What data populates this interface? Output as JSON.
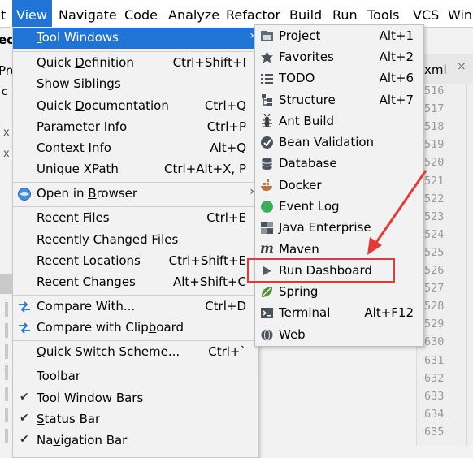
{
  "menubar": {
    "items": [
      "t",
      "View",
      "Navigate",
      "Code",
      "Analyze",
      "Refactor",
      "Build",
      "Run",
      "Tools",
      "VCS",
      "Win"
    ]
  },
  "background": {
    "left_fragments": [
      "ec",
      "Pro",
      "c",
      "x",
      "x"
    ],
    "tab_fragment": "xml",
    "line_numbers": [
      "516",
      "517",
      "518",
      "519",
      "520",
      "521",
      "522",
      "523",
      "524",
      "525",
      "526",
      "527",
      "528",
      "529",
      "630",
      "631",
      "632",
      "633",
      "634",
      "635"
    ]
  },
  "view_menu": {
    "items": [
      {
        "label": "Tool Windows",
        "shortcut": "",
        "submenu": true,
        "highlighted": true
      },
      {
        "label": "Quick Definition",
        "shortcut": "Ctrl+Shift+I"
      },
      {
        "label": "Show Siblings",
        "shortcut": ""
      },
      {
        "label": "Quick Documentation",
        "shortcut": "Ctrl+Q"
      },
      {
        "label": "Parameter Info",
        "shortcut": "Ctrl+P"
      },
      {
        "label": "Context Info",
        "shortcut": "Alt+Q"
      },
      {
        "label": "Unique XPath",
        "shortcut": "Ctrl+Alt+X, P"
      },
      {
        "label": "Open in Browser",
        "shortcut": "",
        "submenu": true,
        "icon": "globe-icon"
      },
      {
        "label": "Recent Files",
        "shortcut": "Ctrl+E"
      },
      {
        "label": "Recently Changed Files",
        "shortcut": ""
      },
      {
        "label": "Recent Locations",
        "shortcut": "Ctrl+Shift+E"
      },
      {
        "label": "Recent Changes",
        "shortcut": "Alt+Shift+C"
      },
      {
        "label": "Compare With...",
        "shortcut": "Ctrl+D",
        "icon": "compare-arrows-icon"
      },
      {
        "label": "Compare with Clipboard",
        "shortcut": "",
        "icon": "compare-arrows-icon"
      },
      {
        "label": "Quick Switch Scheme...",
        "shortcut": "Ctrl+`"
      },
      {
        "label": "Toolbar",
        "shortcut": ""
      },
      {
        "label": "Tool Window Bars",
        "shortcut": "",
        "checked": true
      },
      {
        "label": "Status Bar",
        "shortcut": "",
        "checked": true
      },
      {
        "label": "Navigation Bar",
        "shortcut": "",
        "checked": true
      }
    ]
  },
  "tool_windows": {
    "items": [
      {
        "label": "Project",
        "shortcut": "Alt+1",
        "icon": "project-folder-icon"
      },
      {
        "label": "Favorites",
        "shortcut": "Alt+2",
        "icon": "star-icon"
      },
      {
        "label": "TODO",
        "shortcut": "Alt+6",
        "icon": "todo-list-icon"
      },
      {
        "label": "Structure",
        "shortcut": "Alt+7",
        "icon": "structure-icon"
      },
      {
        "label": "Ant Build",
        "shortcut": "",
        "icon": "ant-icon"
      },
      {
        "label": "Bean Validation",
        "shortcut": "",
        "icon": "bean-icon"
      },
      {
        "label": "Database",
        "shortcut": "",
        "icon": "database-icon"
      },
      {
        "label": "Docker",
        "shortcut": "",
        "icon": "docker-icon"
      },
      {
        "label": "Event Log",
        "shortcut": "",
        "icon": "event-log-icon"
      },
      {
        "label": "Java Enterprise",
        "shortcut": "",
        "icon": "java-enterprise-icon"
      },
      {
        "label": "Maven",
        "shortcut": "",
        "icon": "maven-icon"
      },
      {
        "label": "Run Dashboard",
        "shortcut": "",
        "icon": "run-triangle-icon"
      },
      {
        "label": "Spring",
        "shortcut": "",
        "icon": "spring-leaf-icon"
      },
      {
        "label": "Terminal",
        "shortcut": "Alt+F12",
        "icon": "terminal-icon"
      },
      {
        "label": "Web",
        "shortcut": "",
        "icon": "web-globe-icon"
      }
    ]
  },
  "colors": {
    "highlight": "#1f74d6",
    "annotation": "#e53935",
    "menu_bg": "#f2f2f2"
  }
}
